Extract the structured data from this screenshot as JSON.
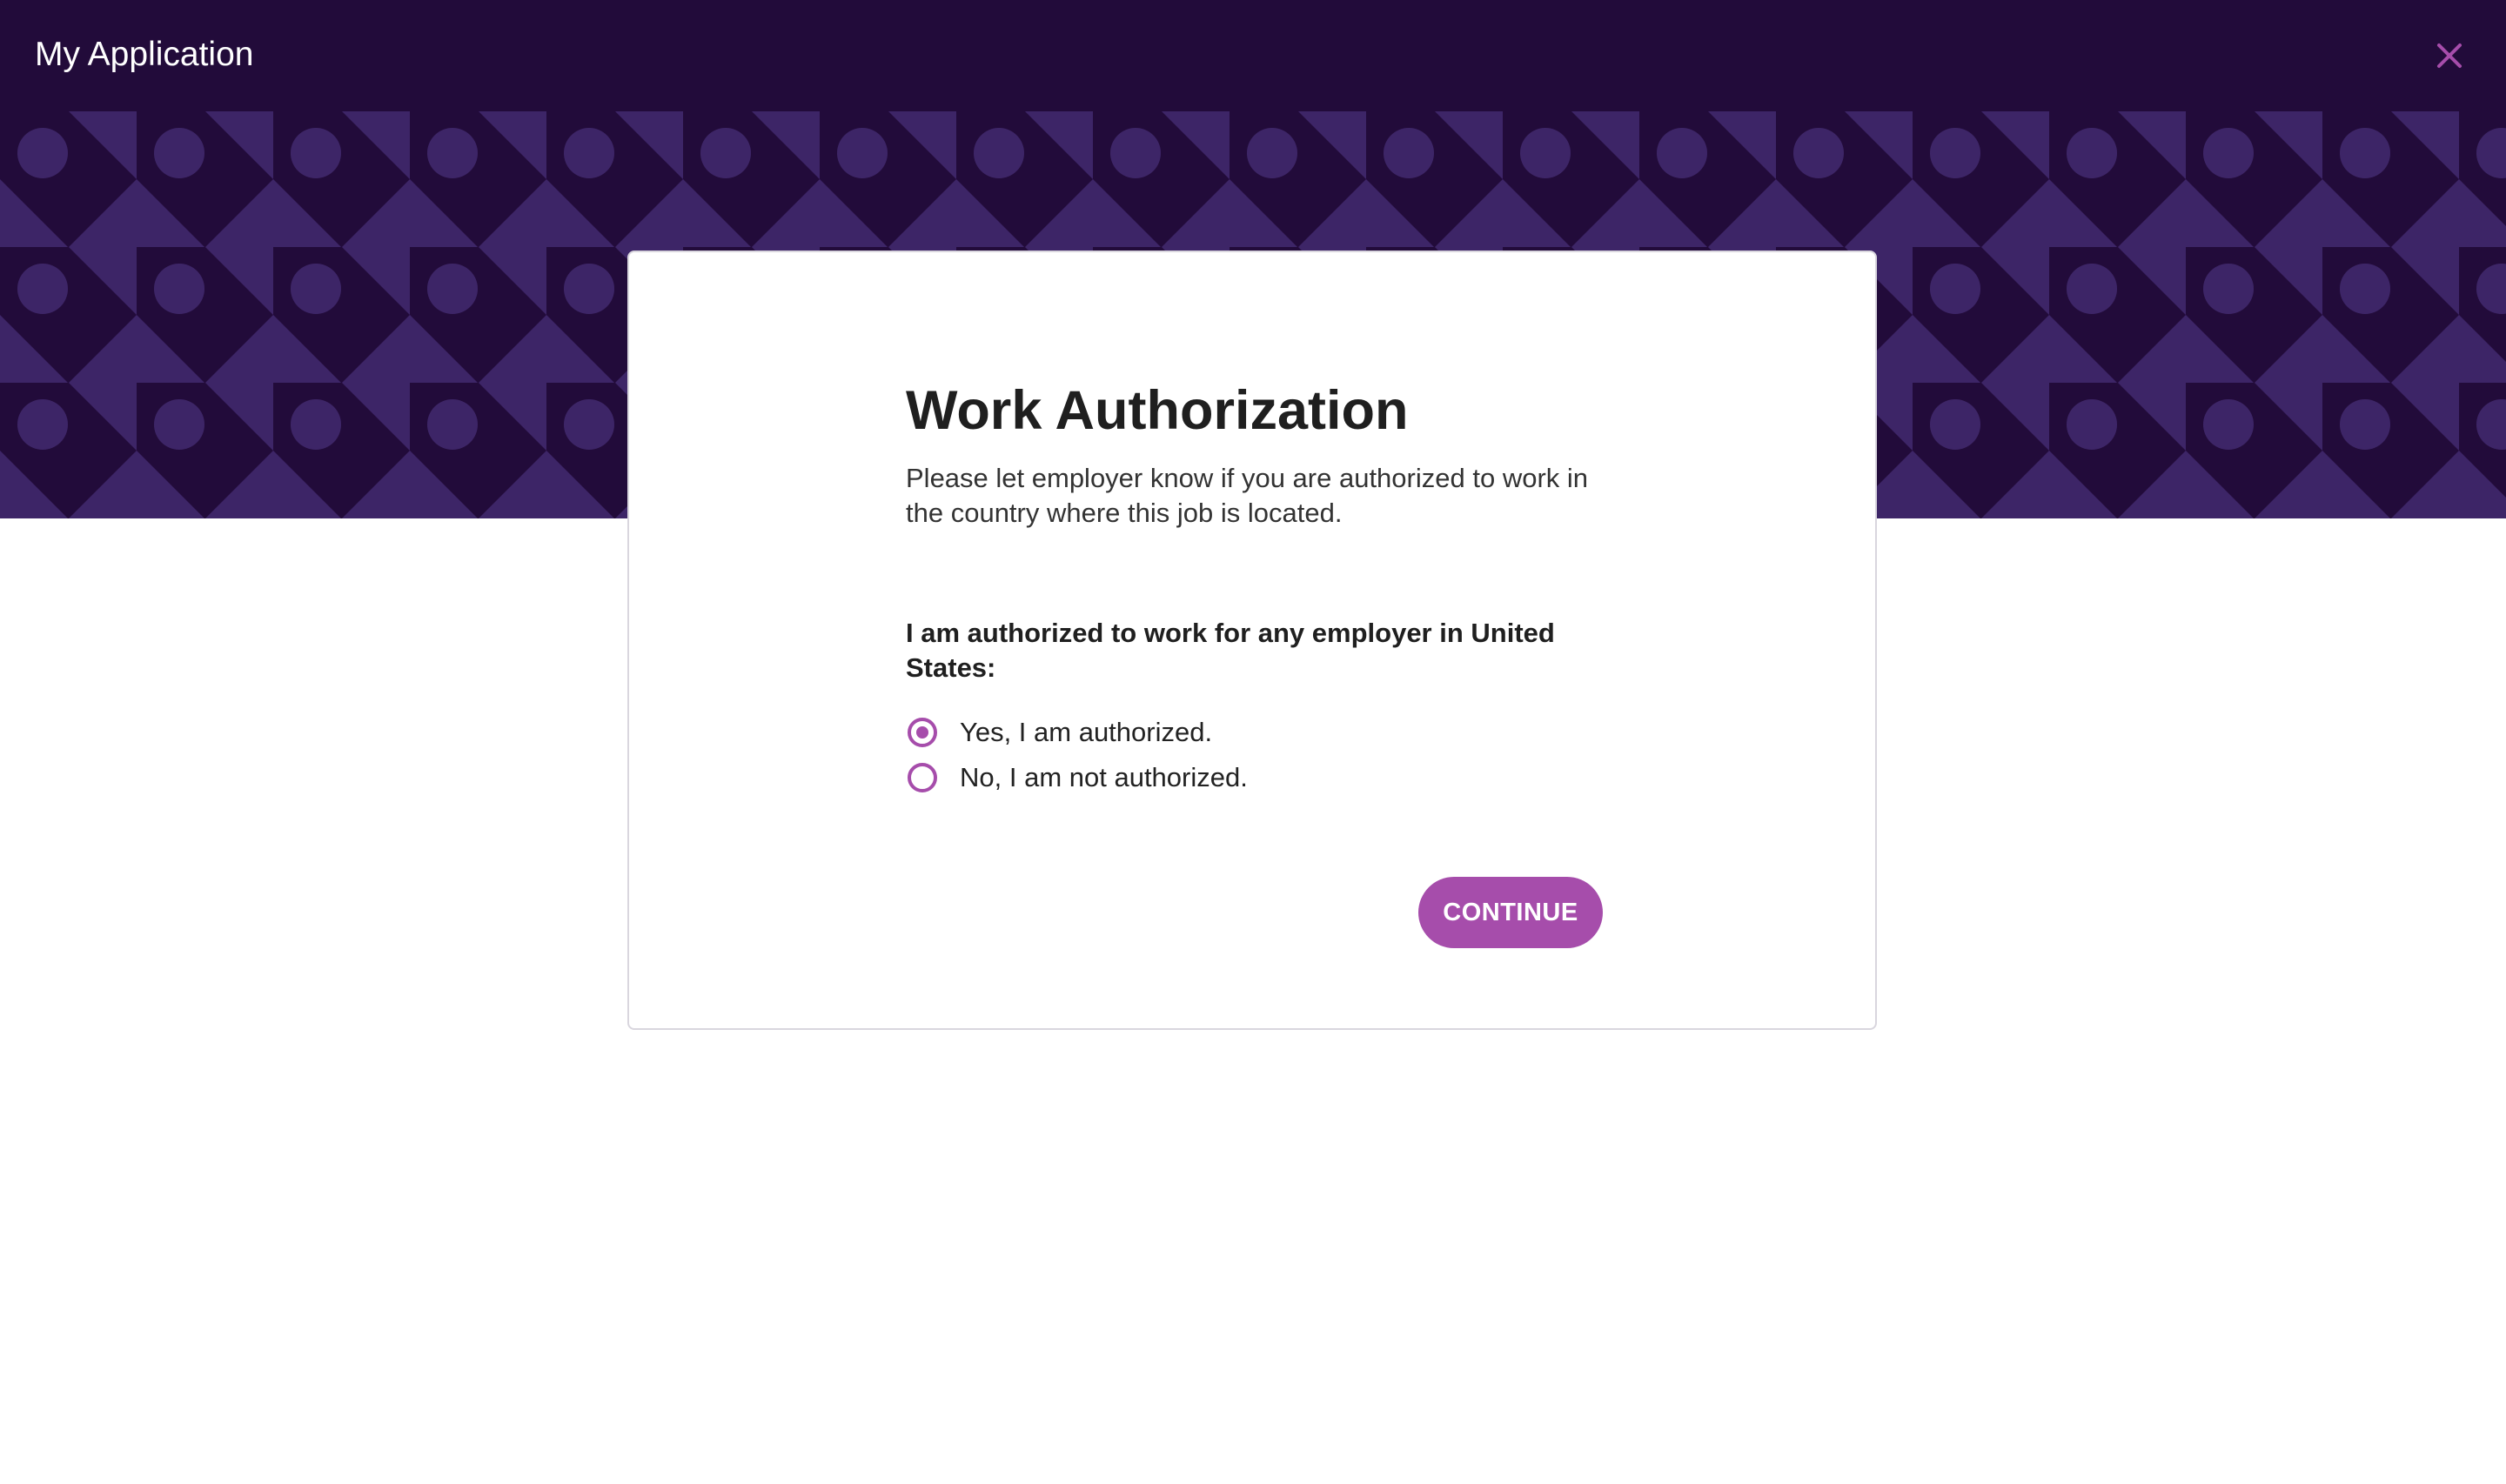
{
  "header": {
    "title": "My Application",
    "close_icon": "close-icon"
  },
  "colors": {
    "header_bg": "#220b3a",
    "pattern_bg": "#220b3a",
    "pattern_fg": "#3d2567",
    "accent": "#a64dab"
  },
  "card": {
    "title": "Work Authorization",
    "subtitle": "Please let employer know if you are authorized to work in the country where this job is located.",
    "question": "I am authorized to work for any employer in United States:",
    "options": [
      {
        "label": "Yes, I am authorized.",
        "checked": true
      },
      {
        "label": "No, I am not authorized.",
        "checked": false
      }
    ],
    "continue_label": "CONTINUE"
  }
}
